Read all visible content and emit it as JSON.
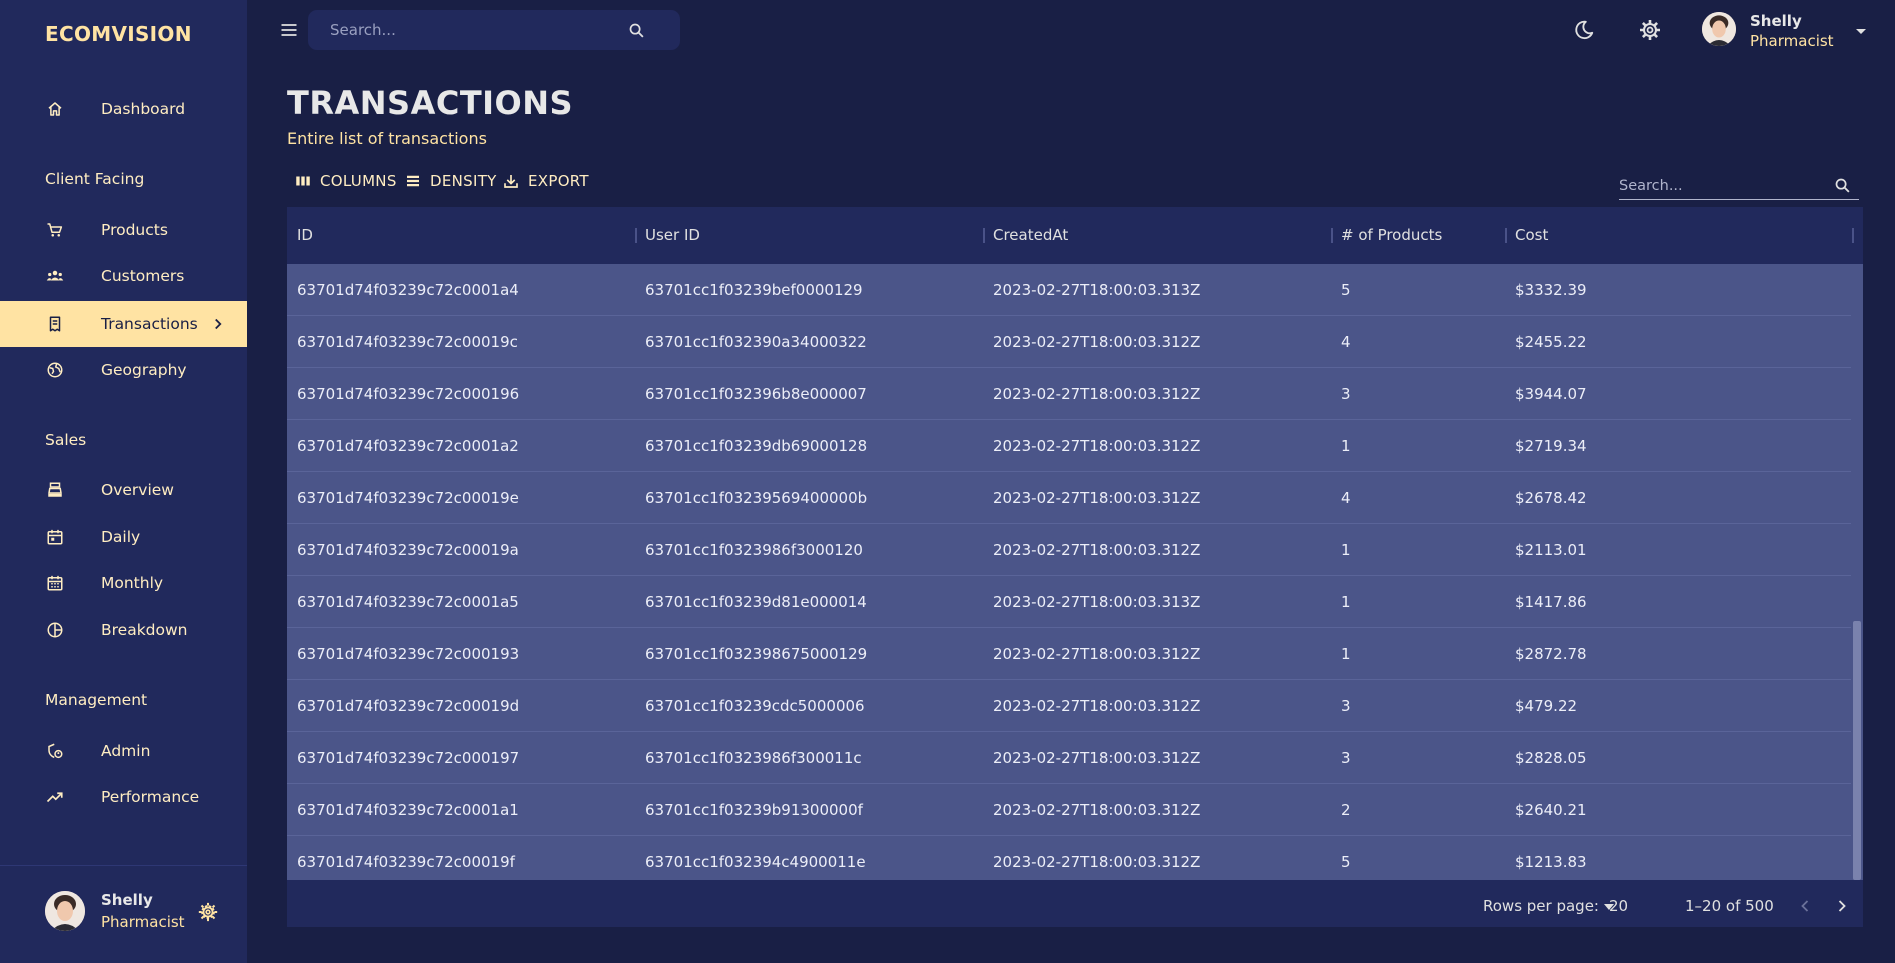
{
  "app": {
    "brand": "ECOMVISION"
  },
  "sidebar": {
    "items": [
      {
        "label": "Dashboard"
      },
      {
        "section": "Client Facing"
      },
      {
        "label": "Products"
      },
      {
        "label": "Customers"
      },
      {
        "label": "Transactions",
        "active": true
      },
      {
        "label": "Geography"
      },
      {
        "section": "Sales"
      },
      {
        "label": "Overview"
      },
      {
        "label": "Daily"
      },
      {
        "label": "Monthly"
      },
      {
        "label": "Breakdown"
      },
      {
        "section": "Management"
      },
      {
        "label": "Admin"
      },
      {
        "label": "Performance"
      }
    ],
    "user": {
      "name": "Shelly",
      "role": "Pharmacist"
    }
  },
  "topbar": {
    "search_placeholder": "Search...",
    "user": {
      "name": "Shelly",
      "role": "Pharmacist"
    }
  },
  "header": {
    "title": "TRANSACTIONS",
    "subtitle": "Entire list of transactions"
  },
  "toolbar": {
    "columns_label": "COLUMNS",
    "density_label": "DENSITY",
    "export_label": "EXPORT",
    "search_placeholder": "Search..."
  },
  "table": {
    "columns": [
      "ID",
      "User ID",
      "CreatedAt",
      "# of Products",
      "Cost"
    ],
    "rows": [
      [
        "63701d74f03239c72c0001a4",
        "63701cc1f03239bef0000129",
        "2023-02-27T18:00:03.313Z",
        "5",
        "$3332.39"
      ],
      [
        "63701d74f03239c72c00019c",
        "63701cc1f032390a34000322",
        "2023-02-27T18:00:03.312Z",
        "4",
        "$2455.22"
      ],
      [
        "63701d74f03239c72c000196",
        "63701cc1f032396b8e000007",
        "2023-02-27T18:00:03.312Z",
        "3",
        "$3944.07"
      ],
      [
        "63701d74f03239c72c0001a2",
        "63701cc1f03239db69000128",
        "2023-02-27T18:00:03.312Z",
        "1",
        "$2719.34"
      ],
      [
        "63701d74f03239c72c00019e",
        "63701cc1f03239569400000b",
        "2023-02-27T18:00:03.312Z",
        "4",
        "$2678.42"
      ],
      [
        "63701d74f03239c72c00019a",
        "63701cc1f0323986f3000120",
        "2023-02-27T18:00:03.312Z",
        "1",
        "$2113.01"
      ],
      [
        "63701d74f03239c72c0001a5",
        "63701cc1f03239d81e000014",
        "2023-02-27T18:00:03.313Z",
        "1",
        "$1417.86"
      ],
      [
        "63701d74f03239c72c000193",
        "63701cc1f032398675000129",
        "2023-02-27T18:00:03.312Z",
        "1",
        "$2872.78"
      ],
      [
        "63701d74f03239c72c00019d",
        "63701cc1f03239cdc5000006",
        "2023-02-27T18:00:03.312Z",
        "3",
        "$479.22"
      ],
      [
        "63701d74f03239c72c000197",
        "63701cc1f0323986f300011c",
        "2023-02-27T18:00:03.312Z",
        "3",
        "$2828.05"
      ],
      [
        "63701d74f03239c72c0001a1",
        "63701cc1f03239b91300000f",
        "2023-02-27T18:00:03.312Z",
        "2",
        "$2640.21"
      ],
      [
        "63701d74f03239c72c00019f",
        "63701cc1f032394c4900011e",
        "2023-02-27T18:00:03.312Z",
        "5",
        "$1213.83"
      ]
    ]
  },
  "pagination": {
    "rows_per_page_label": "Rows per page:",
    "rows_per_page": "20",
    "range": "1–20 of 500"
  },
  "colors": {
    "accent": "#ffe3a3",
    "background": "#191f45",
    "panel": "#21295c",
    "row": "#4b5589"
  }
}
